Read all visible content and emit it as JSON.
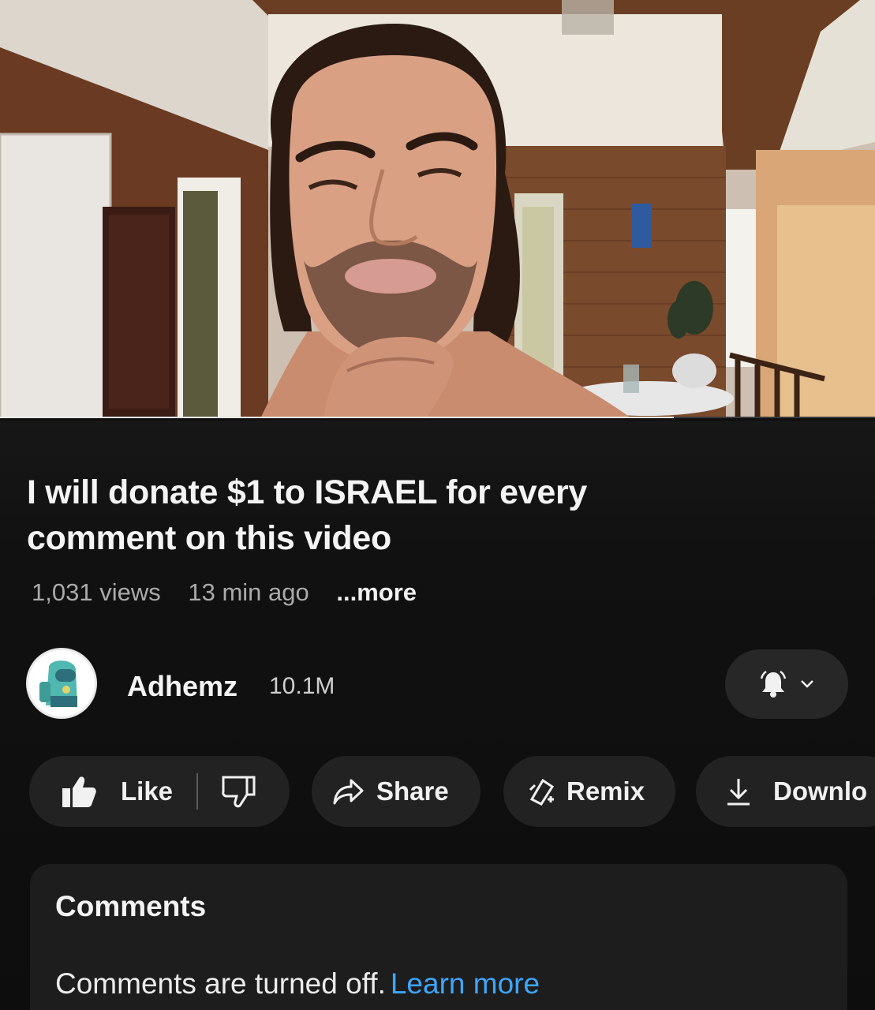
{
  "video": {
    "title": "I will donate $1 to ISRAEL for every comment on this video",
    "views": "1,031 views",
    "age": "13 min ago",
    "more_label": "...more",
    "progress": 0.77
  },
  "channel": {
    "name": "Adhemz",
    "subscribers": "10.1M"
  },
  "actions": {
    "like_label": "Like",
    "share_label": "Share",
    "remix_label": "Remix",
    "download_label": "Downlo"
  },
  "comments": {
    "title": "Comments",
    "disabled_text": "Comments are turned off.",
    "learn_more": "Learn more"
  },
  "icons": {
    "like": "thumbs-up-icon",
    "dislike": "thumbs-down-icon",
    "share": "share-arrow-icon",
    "remix": "remix-icon",
    "download": "download-icon",
    "bell": "bell-icon",
    "chevron": "chevron-down-icon"
  },
  "colors": {
    "background": "#0f0f0f",
    "pill": "#222222",
    "link": "#3ea6ff",
    "muted_text": "#aaaaaa"
  }
}
